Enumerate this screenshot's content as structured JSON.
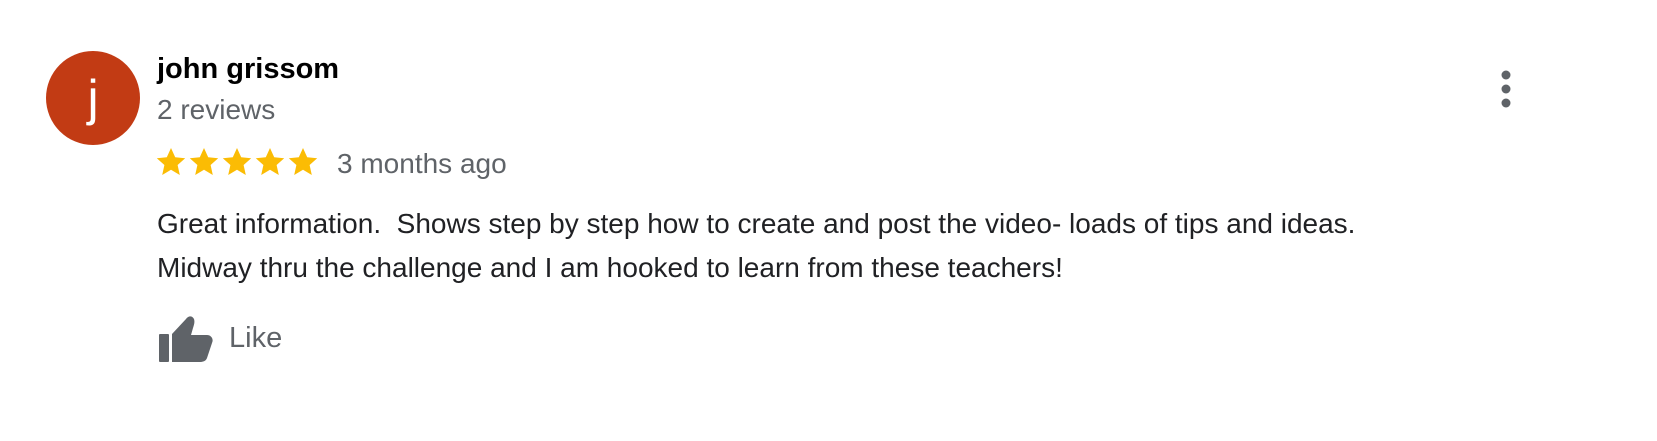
{
  "review": {
    "author": {
      "initial": "j",
      "name": "john grissom",
      "review_count": "2 reviews"
    },
    "rating": {
      "stars": 5,
      "max_stars": 5
    },
    "time": "3 months ago",
    "text_lines": [
      "Great information.  Shows step by step how to create and post the video- loads of tips and ideas.",
      "Midway thru the challenge and I am hooked to learn from these teachers!"
    ],
    "actions": {
      "like_label": "Like",
      "like_icon": "thumbs-up-icon",
      "more_icon": "more-vertical-icon"
    }
  },
  "colors": {
    "avatar_bg": "#c23b14",
    "star": "#fbbc04",
    "icon": "#5f6368",
    "text_primary": "#202124",
    "text_secondary": "#5f6368"
  }
}
